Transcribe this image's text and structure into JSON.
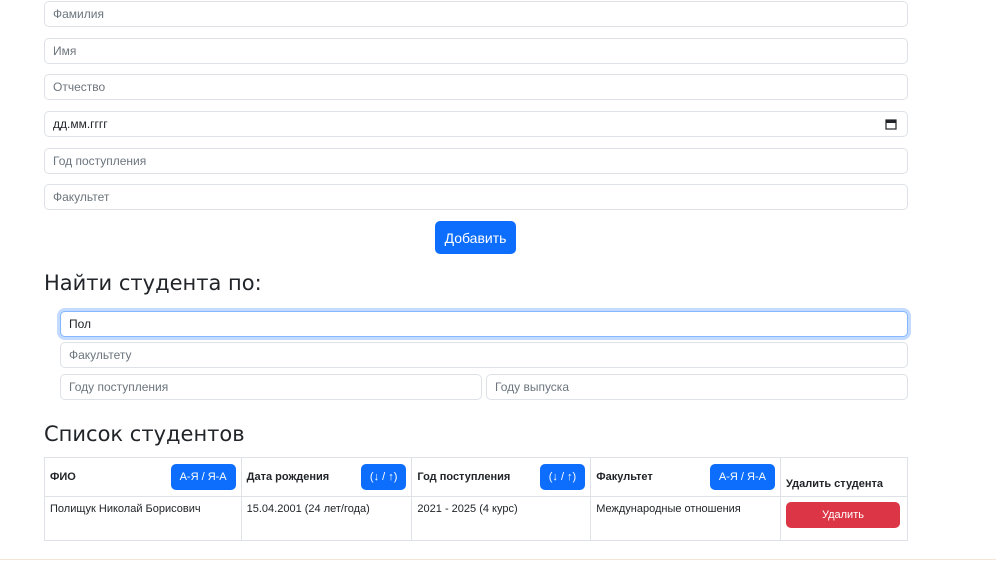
{
  "form": {
    "lastname_placeholder": "Фамилия",
    "firstname_placeholder": "Имя",
    "patronymic_placeholder": "Отчество",
    "birthdate_text": "дд.мм.гггг",
    "enroll_year_placeholder": "Год поступления",
    "faculty_placeholder": "Факультет",
    "add_label": "Добавить"
  },
  "search": {
    "heading": "Найти студента по:",
    "name_value": "Пол",
    "faculty_placeholder": "Факультету",
    "enroll_year_placeholder": "Году поступления",
    "grad_year_placeholder": "Году выпуска"
  },
  "list": {
    "heading": "Список студентов",
    "columns": {
      "fio": "ФИО",
      "fio_sort": "А-Я / Я-А",
      "birth": "Дата рождения",
      "birth_sort": "(↓ / ↑)",
      "enroll": "Год поступления",
      "enroll_sort": "(↓ / ↑)",
      "faculty": "Факультет",
      "faculty_sort": "А-Я / Я-А",
      "delete": "Удалить студента"
    },
    "rows": [
      {
        "fio": "Полищук Николай Борисович",
        "birth": "15.04.2001 (24 лет/года)",
        "enroll": "2021 - 2025 (4 курс)",
        "faculty": "Международные отношения",
        "delete_label": "Удалить"
      }
    ]
  },
  "colors": {
    "primary": "#0d6efd",
    "danger": "#dc3545",
    "border": "#dee2e6"
  }
}
